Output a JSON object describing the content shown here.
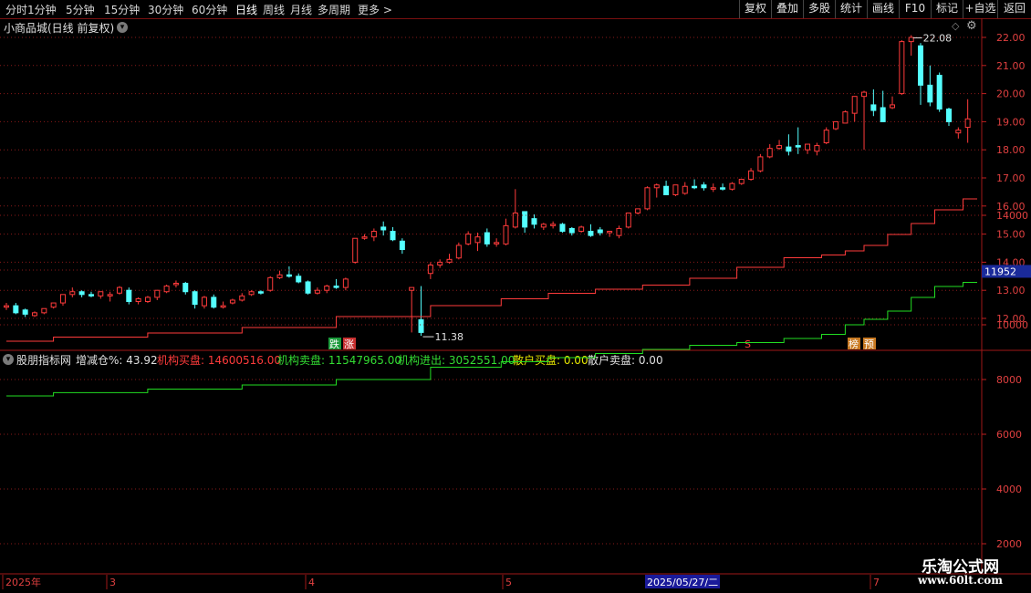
{
  "toolbar": {
    "periods": [
      "分时",
      "1分钟",
      "5分钟",
      "15分钟",
      "30分钟",
      "60分钟",
      "日线",
      "周线",
      "月线",
      "多周期",
      "更多 >"
    ],
    "active_period": "日线",
    "actions": [
      "复权",
      "叠加",
      "多股",
      "统计",
      "画线",
      "F10",
      "标记",
      "+自选",
      "返回"
    ]
  },
  "main_chart": {
    "title": "小商品城(日线 前复权)",
    "high_label": "22.08",
    "low_label": "11.38",
    "event_markers": [
      "跌",
      "涨",
      "S",
      "榜",
      "预"
    ],
    "price_ticks": [
      "22.00",
      "21.00",
      "20.00",
      "19.00",
      "18.00",
      "17.00",
      "16.00",
      "15.00",
      "14.00",
      "13.00",
      "12.00"
    ]
  },
  "indicator": {
    "name": "股朋指标网",
    "fields": [
      {
        "label": "增减仓%:",
        "value": "43.92",
        "color": "#e0e0e0"
      },
      {
        "label": "机构买盘:",
        "value": "14600516.00",
        "color": "#ff3b3b"
      },
      {
        "label": "机构卖盘:",
        "value": "11547965.00",
        "color": "#33dd33"
      },
      {
        "label": "机构进出:",
        "value": "3052551.00",
        "color": "#33dd33"
      },
      {
        "label": "散户买盘:",
        "value": "0.00",
        "color": "#e6e600"
      },
      {
        "label": "散户卖盘:",
        "value": "0.00",
        "color": "#e0e0e0"
      }
    ],
    "ticks": [
      "14000",
      "12000",
      "10000",
      "8000",
      "6000",
      "4000",
      "2000"
    ],
    "cursor_value": "11952"
  },
  "x_axis": {
    "labels": [
      "2025年",
      "3",
      "4",
      "5",
      "6",
      "7"
    ],
    "cursor_date": "2025/05/27/二"
  },
  "watermark": {
    "line1": "乐淘公式网",
    "line2": "www.60lt.com"
  },
  "colors": {
    "up": "#ff3b3b",
    "down": "#54ffff",
    "grid": "#8a1a1a",
    "buy_line": "#ff3b3b",
    "sell_line": "#22dd22"
  },
  "chart_data": [
    {
      "type": "candlestick",
      "title": "小商品城(日线 前复权)",
      "x": [
        "2025-02-05",
        "2025-02-06",
        "2025-02-07",
        "2025-02-10",
        "2025-02-11",
        "2025-02-12",
        "2025-02-13",
        "2025-02-14",
        "2025-02-17",
        "2025-02-18",
        "2025-02-19",
        "2025-02-20",
        "2025-02-21",
        "2025-02-24",
        "2025-02-25",
        "2025-02-26",
        "2025-02-27",
        "2025-02-28",
        "2025-03-03",
        "2025-03-04",
        "2025-03-05",
        "2025-03-06",
        "2025-03-07",
        "2025-03-10",
        "2025-03-11",
        "2025-03-12",
        "2025-03-13",
        "2025-03-14",
        "2025-03-17",
        "2025-03-18",
        "2025-03-19",
        "2025-03-20",
        "2025-03-21",
        "2025-03-24",
        "2025-03-25",
        "2025-03-26",
        "2025-03-27",
        "2025-03-28",
        "2025-03-31",
        "2025-04-01",
        "2025-04-02",
        "2025-04-03",
        "2025-04-07",
        "2025-04-08",
        "2025-04-09",
        "2025-04-10",
        "2025-04-11",
        "2025-04-14",
        "2025-04-15",
        "2025-04-16",
        "2025-04-17",
        "2025-04-18",
        "2025-04-21",
        "2025-04-22",
        "2025-04-23",
        "2025-04-24",
        "2025-04-25",
        "2025-04-28",
        "2025-04-29",
        "2025-04-30",
        "2025-05-06",
        "2025-05-07",
        "2025-05-08",
        "2025-05-09",
        "2025-05-12",
        "2025-05-13",
        "2025-05-14",
        "2025-05-15",
        "2025-05-16",
        "2025-05-19",
        "2025-05-20",
        "2025-05-21",
        "2025-05-22",
        "2025-05-23",
        "2025-05-26",
        "2025-05-27",
        "2025-05-28",
        "2025-05-29",
        "2025-05-30",
        "2025-06-03",
        "2025-06-04",
        "2025-06-05",
        "2025-06-06",
        "2025-06-09",
        "2025-06-10",
        "2025-06-11",
        "2025-06-12",
        "2025-06-13",
        "2025-06-16",
        "2025-06-17",
        "2025-06-18",
        "2025-06-19",
        "2025-06-20",
        "2025-06-23",
        "2025-06-24",
        "2025-06-25",
        "2025-06-26",
        "2025-06-27",
        "2025-06-30",
        "2025-07-01",
        "2025-07-02",
        "2025-07-03",
        "2025-07-04"
      ],
      "open": [
        12.4,
        12.45,
        12.3,
        12.1,
        12.2,
        12.4,
        12.55,
        12.85,
        12.95,
        12.85,
        12.8,
        12.8,
        12.9,
        13.0,
        12.6,
        12.6,
        12.75,
        12.95,
        13.2,
        13.25,
        12.95,
        12.45,
        12.75,
        12.4,
        12.55,
        12.65,
        12.85,
        12.95,
        13.0,
        13.45,
        13.55,
        13.5,
        13.3,
        12.9,
        13.0,
        13.15,
        13.1,
        14.0,
        14.85,
        14.9,
        15.25,
        15.1,
        14.75,
        13.0,
        11.95,
        13.6,
        13.9,
        14.0,
        14.15,
        14.65,
        14.7,
        15.05,
        14.65,
        14.65,
        15.25,
        15.8,
        15.55,
        15.25,
        15.3,
        15.35,
        15.2,
        15.1,
        15.1,
        15.15,
        15.05,
        14.95,
        15.25,
        15.75,
        15.9,
        16.65,
        16.7,
        16.4,
        16.45,
        16.7,
        16.75,
        16.6,
        16.65,
        16.6,
        16.8,
        16.95,
        17.25,
        17.75,
        18.05,
        18.1,
        18.15,
        18.0,
        17.95,
        18.25,
        18.75,
        18.95,
        19.3,
        19.9,
        19.6,
        19.5,
        19.5,
        20.0,
        21.85,
        21.7,
        20.3,
        20.65,
        19.45,
        18.6,
        18.8
      ],
      "high": [
        12.55,
        12.55,
        12.35,
        12.25,
        12.35,
        12.55,
        12.85,
        13.1,
        13.0,
        12.95,
        12.95,
        12.95,
        13.15,
        13.1,
        12.75,
        12.8,
        13.0,
        13.2,
        13.35,
        13.3,
        13.0,
        12.8,
        12.85,
        12.6,
        12.7,
        12.9,
        13.0,
        13.0,
        13.5,
        13.7,
        13.85,
        13.6,
        13.35,
        13.1,
        13.2,
        13.4,
        13.45,
        14.8,
        15.0,
        15.2,
        15.45,
        15.25,
        14.85,
        13.05,
        13.15,
        14.0,
        14.1,
        14.3,
        14.7,
        15.1,
        15.05,
        15.2,
        14.85,
        15.55,
        16.6,
        15.8,
        15.7,
        15.4,
        15.45,
        15.4,
        15.25,
        15.3,
        15.35,
        15.25,
        15.1,
        15.3,
        15.7,
        15.9,
        16.7,
        16.8,
        16.9,
        16.65,
        16.85,
        16.95,
        16.85,
        16.8,
        16.8,
        16.85,
        16.95,
        17.35,
        17.85,
        18.2,
        18.35,
        18.55,
        18.8,
        18.2,
        18.25,
        18.8,
        18.9,
        19.4,
        19.6,
        20.1,
        20.15,
        20.1,
        19.9,
        21.9,
        22.08,
        21.8,
        21.0,
        20.75,
        19.5,
        18.8,
        19.8
      ],
      "low": [
        12.3,
        12.15,
        12.05,
        12.05,
        12.15,
        12.35,
        12.45,
        12.75,
        12.75,
        12.75,
        12.7,
        12.6,
        12.85,
        12.5,
        12.5,
        12.55,
        12.65,
        12.9,
        13.1,
        12.85,
        12.35,
        12.35,
        12.35,
        12.35,
        12.5,
        12.6,
        12.8,
        12.85,
        12.95,
        13.4,
        13.45,
        13.25,
        12.85,
        12.85,
        12.9,
        13.05,
        13.0,
        13.95,
        14.8,
        14.75,
        14.95,
        14.75,
        14.3,
        11.5,
        11.38,
        13.4,
        13.8,
        13.95,
        14.1,
        14.6,
        14.4,
        14.55,
        14.55,
        14.6,
        15.2,
        15.05,
        15.2,
        15.15,
        15.2,
        15.05,
        14.95,
        15.05,
        14.9,
        14.95,
        14.9,
        14.85,
        15.2,
        15.7,
        15.85,
        16.3,
        16.4,
        16.35,
        16.4,
        16.6,
        16.55,
        16.5,
        16.55,
        16.55,
        16.75,
        16.9,
        17.2,
        17.7,
        18.0,
        17.8,
        17.85,
        17.85,
        17.8,
        18.2,
        18.7,
        18.95,
        19.0,
        18.0,
        19.2,
        19.0,
        19.45,
        19.95,
        21.35,
        19.6,
        19.55,
        19.35,
        18.85,
        18.4,
        18.25
      ],
      "close": [
        12.45,
        12.2,
        12.15,
        12.2,
        12.35,
        12.55,
        12.85,
        12.95,
        12.85,
        12.8,
        12.95,
        12.85,
        13.1,
        12.6,
        12.7,
        12.75,
        13.0,
        13.15,
        13.25,
        12.95,
        12.5,
        12.75,
        12.4,
        12.45,
        12.65,
        12.8,
        12.95,
        12.9,
        13.45,
        13.55,
        13.5,
        13.3,
        12.9,
        13.0,
        13.15,
        13.1,
        13.4,
        14.85,
        14.9,
        15.1,
        15.15,
        14.8,
        14.45,
        13.1,
        11.5,
        13.9,
        14.0,
        14.1,
        14.6,
        15.0,
        14.9,
        14.65,
        14.7,
        15.3,
        15.75,
        15.25,
        15.35,
        15.35,
        15.35,
        15.1,
        15.05,
        15.25,
        14.95,
        15.05,
        15.1,
        15.2,
        15.75,
        15.9,
        16.65,
        16.75,
        16.4,
        16.75,
        16.7,
        16.65,
        16.65,
        16.65,
        16.6,
        16.8,
        16.95,
        17.25,
        17.75,
        18.05,
        18.15,
        17.95,
        18.1,
        18.2,
        18.15,
        18.7,
        19.0,
        19.35,
        19.9,
        20.05,
        19.4,
        19.0,
        19.6,
        21.85,
        22.0,
        20.3,
        19.7,
        19.45,
        19.0,
        18.7,
        19.1
      ]
    },
    {
      "type": "line",
      "title": "股朋指标网",
      "ylim": [
        2000,
        14000
      ],
      "x_index": [
        0,
        10,
        20,
        30,
        40,
        50,
        55,
        60,
        65,
        70,
        75,
        80,
        85,
        88,
        90,
        92,
        95,
        97,
        100,
        103
      ],
      "series": [
        {
          "name": "机构买盘",
          "color": "#ff3b3b",
          "values": [
            9400,
            9550,
            9700,
            9900,
            10300,
            10700,
            10950,
            11150,
            11300,
            11450,
            11700,
            12100,
            12450,
            12550,
            12700,
            12900,
            13300,
            13700,
            14200,
            14600
          ]
        },
        {
          "name": "机构卖盘",
          "color": "#22dd22",
          "values": [
            7400,
            7520,
            7650,
            7800,
            8000,
            8450,
            8650,
            8800,
            8950,
            9100,
            9250,
            9350,
            9500,
            9650,
            10000,
            10200,
            10500,
            11000,
            11400,
            11550
          ]
        }
      ]
    }
  ]
}
